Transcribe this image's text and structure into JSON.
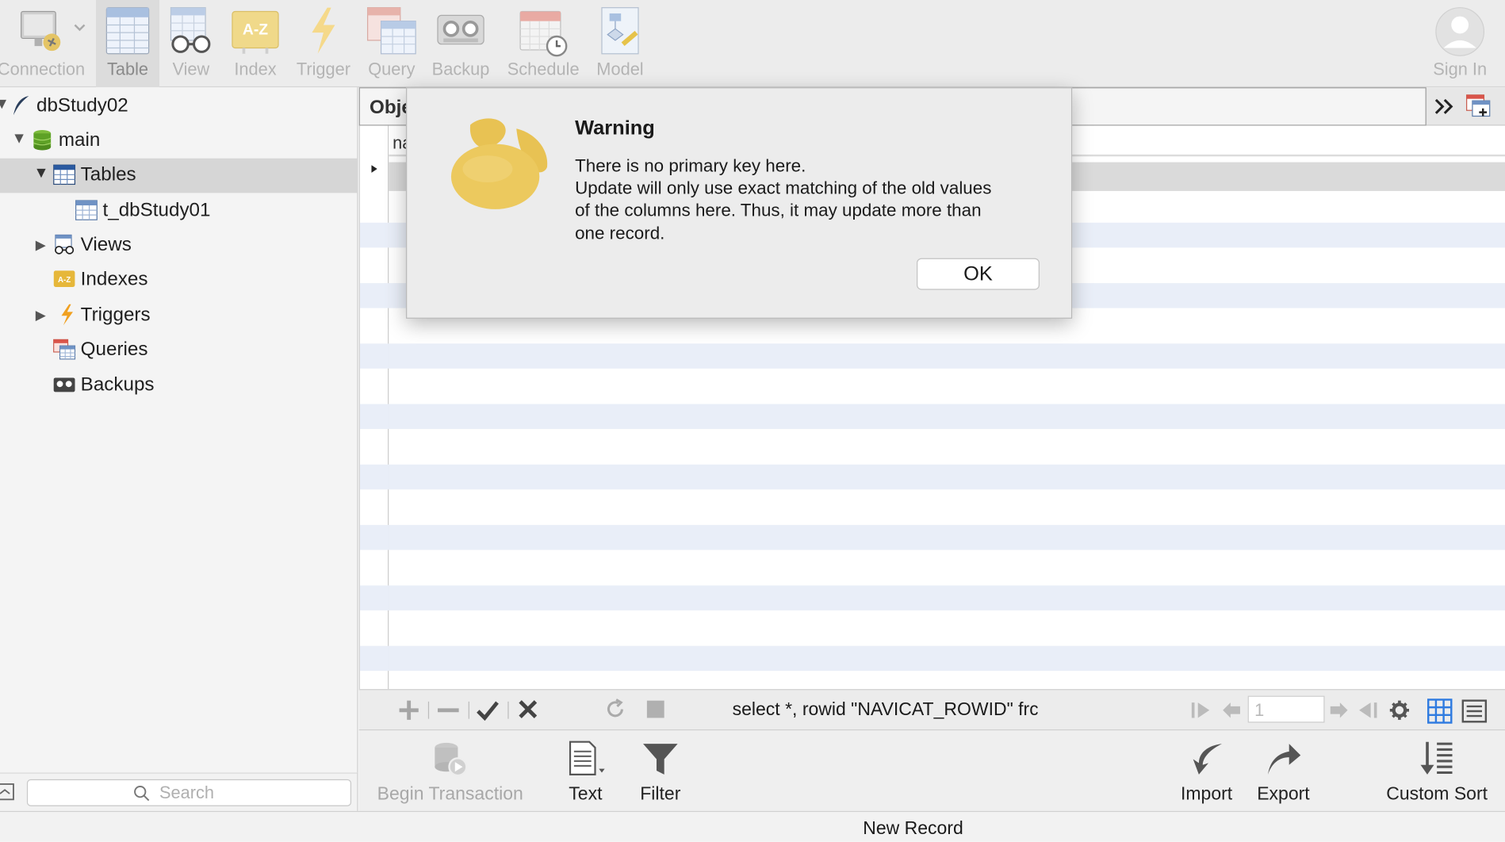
{
  "toolbar": {
    "items": [
      {
        "label": "Connection",
        "icon": "connection-icon"
      },
      {
        "label": "Table",
        "icon": "table-icon"
      },
      {
        "label": "View",
        "icon": "view-icon"
      },
      {
        "label": "Index",
        "icon": "index-icon"
      },
      {
        "label": "Trigger",
        "icon": "trigger-icon"
      },
      {
        "label": "Query",
        "icon": "query-icon"
      },
      {
        "label": "Backup",
        "icon": "backup-icon"
      },
      {
        "label": "Schedule",
        "icon": "schedule-icon"
      },
      {
        "label": "Model",
        "icon": "model-icon"
      }
    ],
    "sign_in": "Sign In"
  },
  "sidebar": {
    "tree": {
      "db": "dbStudy02",
      "schema": "main",
      "tables": "Tables",
      "table_item": "t_dbStudy01",
      "views": "Views",
      "indexes": "Indexes",
      "triggers": "Triggers",
      "queries": "Queries",
      "backups": "Backups"
    },
    "search_placeholder": "Search"
  },
  "main": {
    "tab_label": "Obje",
    "column_header": "na",
    "sql_text": "select *, rowid \"NAVICAT_ROWID\" frc",
    "page_number": "1"
  },
  "bottom_toolbar": {
    "begin_transaction": "Begin Transaction",
    "text": "Text",
    "filter": "Filter",
    "import": "Import",
    "export": "Export",
    "custom_sort": "Custom Sort"
  },
  "status": "New Record",
  "dialog": {
    "title": "Warning",
    "lines": [
      "There is no primary key here.",
      "Update will only use exact matching of the old values",
      "of the columns here. Thus, it may update more than",
      "one record."
    ],
    "ok_label": "OK"
  },
  "colors": {
    "toolbar_bg": "#ececec",
    "stripe": "#e9eef8",
    "selection": "#d6d6d6",
    "icon_gold": "#e6c34a"
  }
}
